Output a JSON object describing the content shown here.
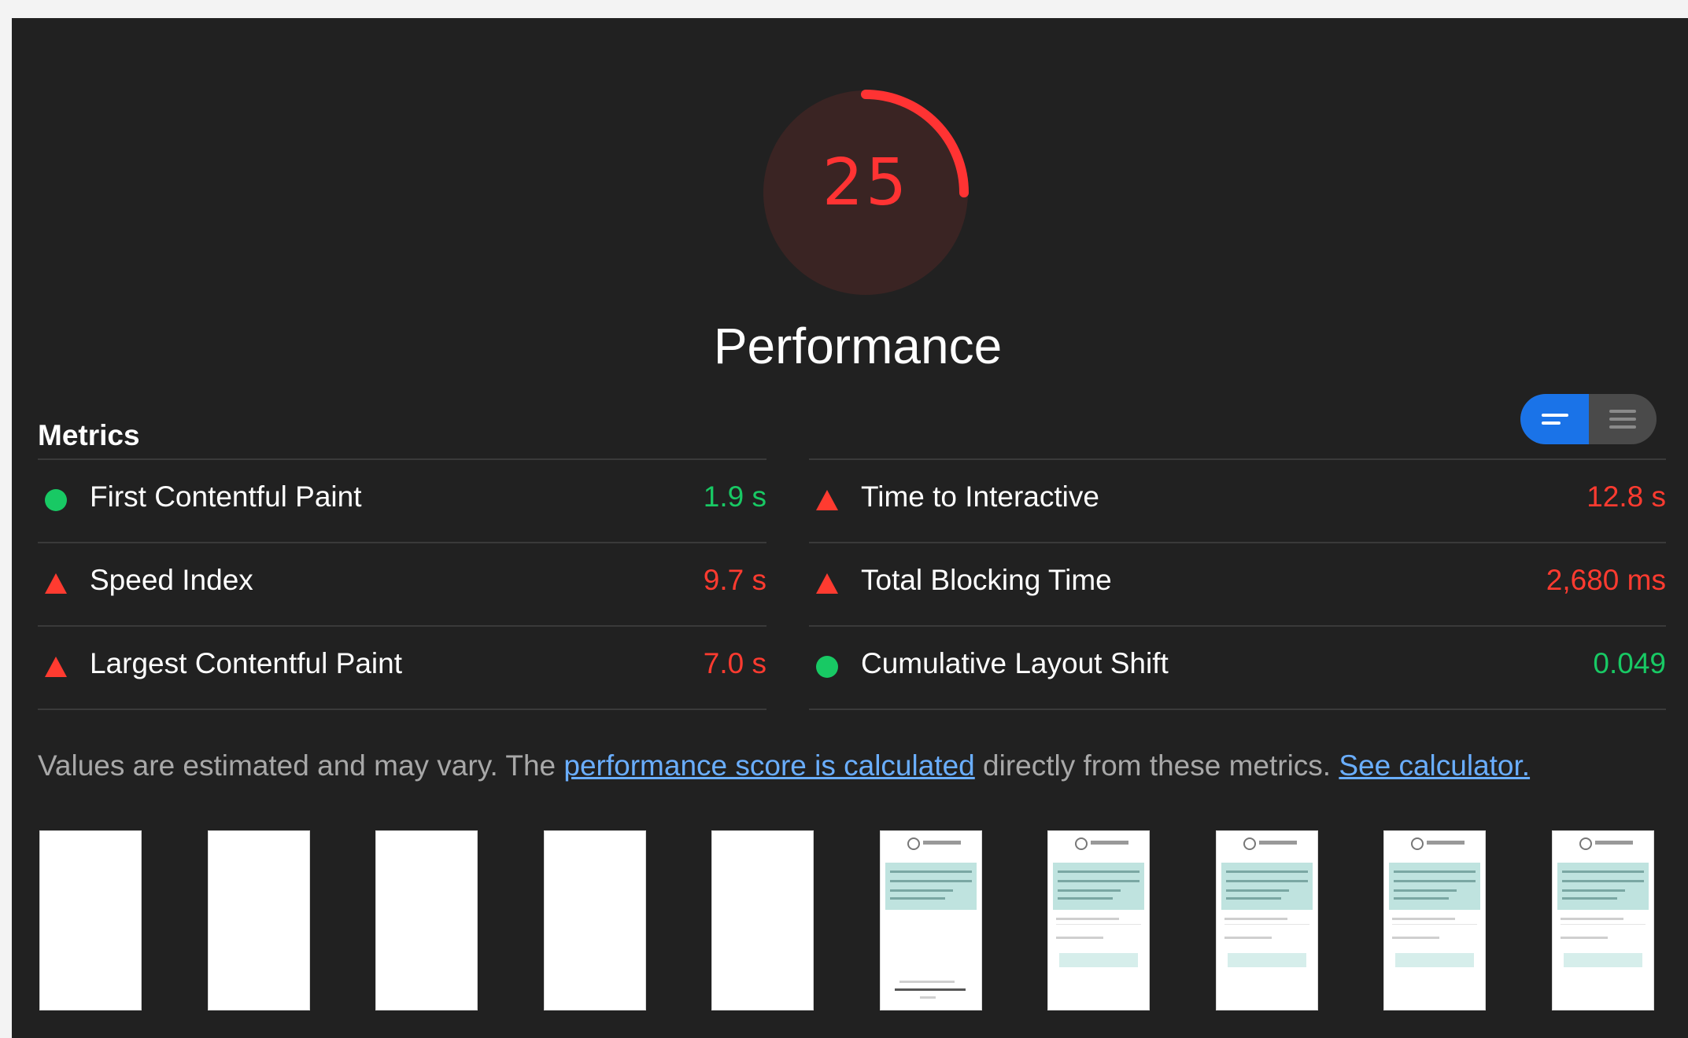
{
  "score": {
    "value": "25",
    "fraction": 0.25,
    "color": "#ff3333",
    "category": "Performance"
  },
  "metrics": {
    "title": "Metrics",
    "toggle": {
      "active": "compact-view-icon",
      "inactive": "expanded-view-icon",
      "active_color": "#1a73e8"
    },
    "left": [
      {
        "label": "First Contentful Paint",
        "value": "1.9 s",
        "status": "good",
        "icon": "green-circle-icon"
      },
      {
        "label": "Speed Index",
        "value": "9.7 s",
        "status": "bad",
        "icon": "red-triangle-icon"
      },
      {
        "label": "Largest Contentful Paint",
        "value": "7.0 s",
        "status": "bad",
        "icon": "red-triangle-icon"
      }
    ],
    "right": [
      {
        "label": "Time to Interactive",
        "value": "12.8 s",
        "status": "bad",
        "icon": "red-triangle-icon"
      },
      {
        "label": "Total Blocking Time",
        "value": "2,680 ms",
        "status": "bad",
        "icon": "red-triangle-icon"
      },
      {
        "label": "Cumulative Layout Shift",
        "value": "0.049",
        "status": "good",
        "icon": "green-circle-icon"
      }
    ]
  },
  "note": {
    "prefix": "Values are estimated and may vary. The ",
    "link1": "performance score is calculated",
    "middle": " directly from these metrics. ",
    "link2": "See calculator."
  },
  "filmstrip": {
    "frames": [
      "blank",
      "blank",
      "blank",
      "blank",
      "blank",
      "page",
      "page",
      "page",
      "page",
      "page"
    ]
  },
  "colors": {
    "background": "#212121",
    "good": "#18c964",
    "bad": "#ff3b30",
    "link": "#6aaeff"
  }
}
